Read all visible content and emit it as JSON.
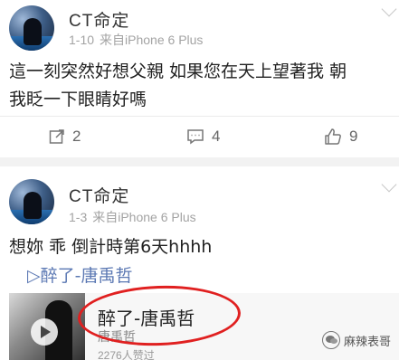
{
  "posts": [
    {
      "author": "CT命定",
      "date": "1-10",
      "source": "来自iPhone 6 Plus",
      "text_line1": "這一刻突然好想父親 如果您在天上望著我 朝",
      "text_line2": "我眨一下眼睛好嗎",
      "repost_count": "2",
      "comment_count": "4",
      "like_count": "9"
    },
    {
      "author": "CT命定",
      "date": "1-3",
      "source": "来自iPhone 6 Plus",
      "text": "想妳 乖 倒計時第6天hhhh",
      "music_link": "▷醉了-唐禹哲",
      "music_card": {
        "title": "醉了-唐禹哲",
        "artist": "唐禹哲",
        "likes": "2276人赞过"
      }
    }
  ],
  "watermark": "麻辣表哥",
  "colors": {
    "link": "#5b78b3",
    "highlight_circle": "#e02020",
    "meta_gray": "#a3a3a3"
  },
  "icons": [
    "avatar",
    "chevron-down-icon",
    "repost-icon",
    "comment-icon",
    "like-icon",
    "play-icon",
    "wechat-logo-icon"
  ]
}
